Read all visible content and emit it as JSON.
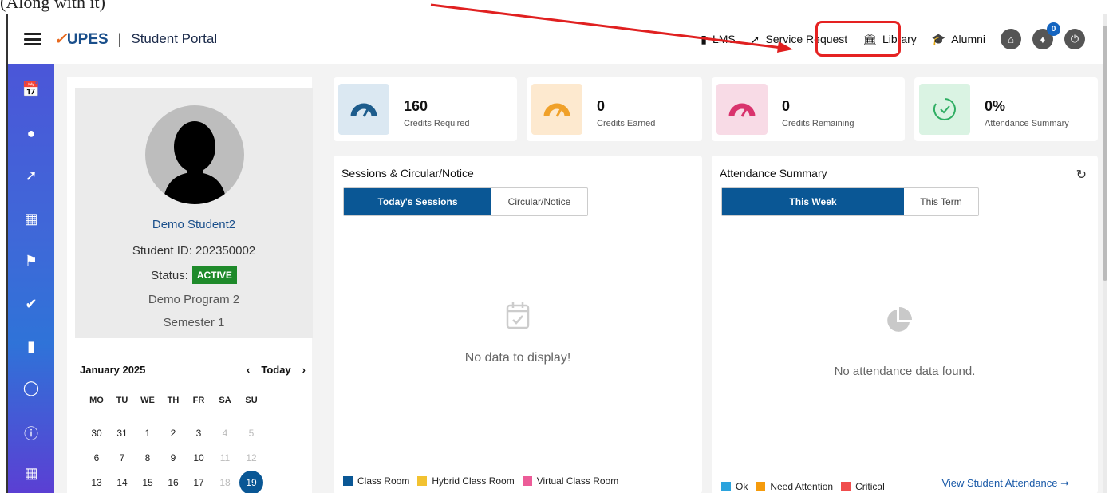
{
  "caption": "(Along with it)",
  "header": {
    "brand": "UPES",
    "portal_title": "Student Portal",
    "nav": [
      {
        "label": "LMS",
        "icon": "book-icon"
      },
      {
        "label": "Service Request",
        "icon": "wrench-icon"
      },
      {
        "label": "Library",
        "icon": "bank-icon"
      },
      {
        "label": "Alumni",
        "icon": "graduation-cap-icon"
      }
    ],
    "notification_count": "0"
  },
  "sidebar": {
    "items": [
      "calendar-icon",
      "user-icon",
      "wrench-icon",
      "calendar-grid-icon",
      "flag-icon",
      "check-icon",
      "file-icon",
      "lightbulb-icon",
      "info-icon",
      "building-icon"
    ]
  },
  "profile": {
    "name": "Demo Student2",
    "student_id": "Student ID: 202350002",
    "status_label": "Status:",
    "status": "ACTIVE",
    "program": "Demo Program 2",
    "semester": "Semester 1"
  },
  "calendar": {
    "month": "January 2025",
    "prev": "‹",
    "today": "Today",
    "next": "›",
    "weekdays": [
      "MO",
      "TU",
      "WE",
      "TH",
      "FR",
      "SA",
      "SU"
    ],
    "weeks": [
      [
        "30",
        "31",
        "1",
        "2",
        "3",
        "4",
        "5"
      ],
      [
        "6",
        "7",
        "8",
        "9",
        "10",
        "11",
        "12"
      ],
      [
        "13",
        "14",
        "15",
        "16",
        "17",
        "18",
        "19"
      ]
    ],
    "selected": "19"
  },
  "stats": [
    {
      "value": "160",
      "label": "Credits Required",
      "bg": "#dbe8f2",
      "color": "#1d5c8c"
    },
    {
      "value": "0",
      "label": "Credits Earned",
      "bg": "#fde9cf",
      "color": "#f0a12a"
    },
    {
      "value": "0",
      "label": "Credits Remaining",
      "bg": "#f8dbe6",
      "color": "#d9336d"
    },
    {
      "value": "0%",
      "label": "Attendance Summary",
      "bg": "#daf3e3",
      "color": "#2fae63"
    }
  ],
  "sessions": {
    "title": "Sessions & Circular/Notice",
    "tabs": [
      "Today's Sessions",
      "Circular/Notice"
    ],
    "empty": "No data to display!",
    "legend": [
      {
        "label": "Class Room",
        "color": "#0a5795"
      },
      {
        "label": "Hybrid Class Room",
        "color": "#f2c231"
      },
      {
        "label": "Virtual Class Room",
        "color": "#ec5c98"
      }
    ]
  },
  "attendance": {
    "title": "Attendance Summary",
    "tabs": [
      "This Week",
      "This Term"
    ],
    "empty": "No attendance data found.",
    "legend": [
      {
        "label": "Ok",
        "color": "#2ba3dd"
      },
      {
        "label": "Need Attention",
        "color": "#f59b0c"
      },
      {
        "label": "Critical",
        "color": "#f04d4d"
      }
    ],
    "view_link": "View Student Attendance ➞"
  },
  "colors": {
    "brand_blue": "#0a5795",
    "highlight": "#e52222"
  }
}
